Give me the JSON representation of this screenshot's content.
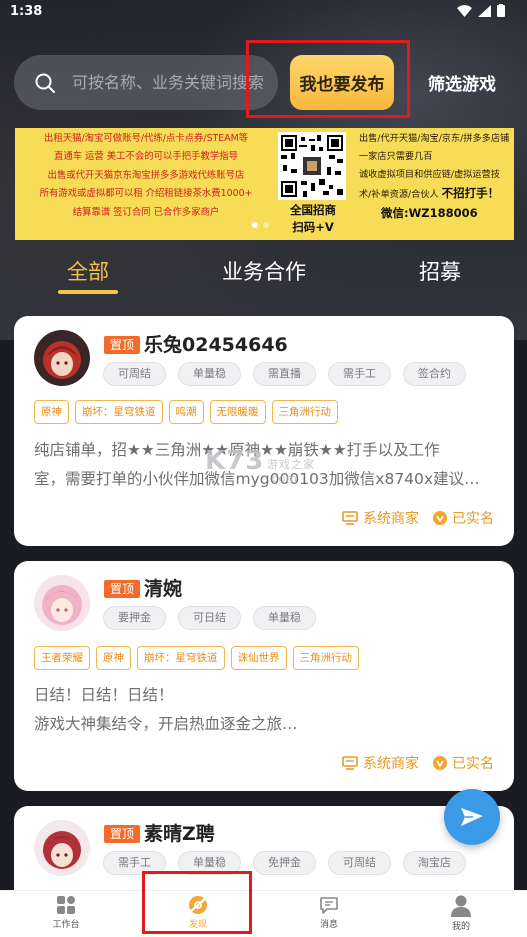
{
  "status_bar": {
    "time": "1:38"
  },
  "search": {
    "placeholder": "可按名称、业务关键词搜索"
  },
  "publish_label": "我也要发布",
  "filter_label": "筛选游戏",
  "banner": {
    "left_lines": [
      "出租天猫/淘宝可做账号/代练/点卡点券/STEAM等",
      "直通车 运营 美工不会的可以手把手教学指导",
      "出售或代开天猫京东淘宝拼多多游戏代练账号店",
      "所有游戏或虚拟都可以租 介绍租链接茶水费1000+",
      "结算靠谱 签订合同 已合作多家商户"
    ],
    "qr_label_line1": "全国招商",
    "qr_label_line2": "扫码+V",
    "right_lines": [
      "出售/代开天猫/淘宝/京东/拼多多店铺",
      "一家店只需要几百",
      "诚收虚拟项目和供应链/虚拟运营技",
      "术/补单资源/合伙人"
    ],
    "right_strong": "不招打手！",
    "wechat": "微信:WZ188006"
  },
  "tabs": [
    "全部",
    "业务合作",
    "招募"
  ],
  "cards": [
    {
      "pin": "置顶",
      "name": "乐兔02454646",
      "chips": [
        "可周结",
        "单量稳",
        "需直播",
        "需手工",
        "签合约"
      ],
      "games": [
        "原神",
        "崩坏：星穹铁道",
        "鸣潮",
        "无限暖暖",
        "三角洲行动"
      ],
      "desc": [
        "纯店铺单，招★★三角洲★★原神★★崩铁★★打手以及工作",
        "室，需要打单的小伙伴加微信myg000103加微信x8740x建议…"
      ],
      "merchant": "系统商家",
      "verified": "已实名"
    },
    {
      "pin": "置顶",
      "name": "清婉",
      "chips": [
        "要押金",
        "可日结",
        "单量稳"
      ],
      "games": [
        "王者荣耀",
        "原神",
        "崩坏：星穹铁道",
        "诛仙世界",
        "三角洲行动"
      ],
      "desc": [
        "日结！日结！日结！",
        "游戏大神集结令，开启热血逐金之旅…"
      ],
      "merchant": "系统商家",
      "verified": "已实名"
    },
    {
      "pin": "置顶",
      "name": "素晴Z聘",
      "chips": [
        "需手工",
        "单量稳",
        "免押金",
        "可周结",
        "淘宝店"
      ]
    }
  ],
  "watermark": {
    "main": "K73",
    "sub": "游戏之家",
    "domain": ".com"
  },
  "nav": [
    "工作台",
    "发现",
    "消息",
    "我的"
  ],
  "colors": {
    "accent": "#f3c24a",
    "pin": "#f26b2a",
    "fab": "#3b9ae8",
    "highlight": "#e11b1b"
  }
}
